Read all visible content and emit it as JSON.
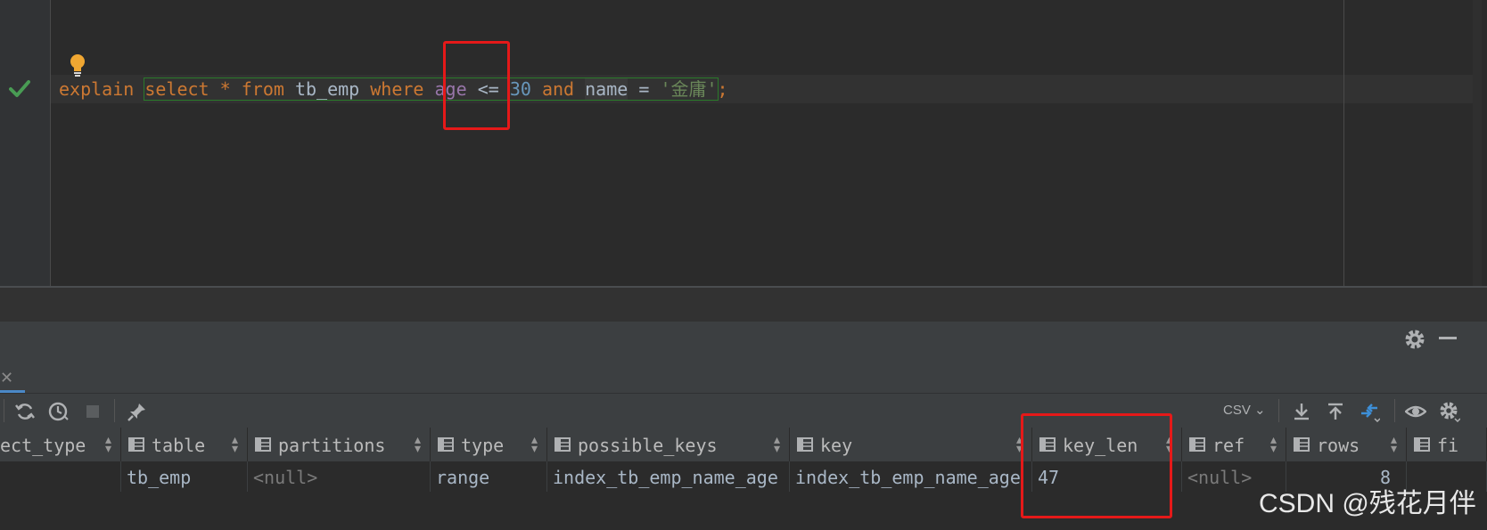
{
  "editor": {
    "tokens": [
      {
        "t": "explain",
        "c": "kw"
      },
      {
        "t": " ",
        "c": "op"
      },
      {
        "t": "select",
        "c": "kw"
      },
      {
        "t": " ",
        "c": "op"
      },
      {
        "t": "*",
        "c": "kw"
      },
      {
        "t": " ",
        "c": "op"
      },
      {
        "t": "from",
        "c": "kw"
      },
      {
        "t": " ",
        "c": "op"
      },
      {
        "t": "tb_emp",
        "c": "ident"
      },
      {
        "t": " ",
        "c": "op"
      },
      {
        "t": "where",
        "c": "kw"
      },
      {
        "t": " ",
        "c": "op"
      },
      {
        "t": "age",
        "c": "col"
      },
      {
        "t": " ",
        "c": "op"
      },
      {
        "t": "<=",
        "c": "op"
      },
      {
        "t": " ",
        "c": "op"
      },
      {
        "t": "30",
        "c": "num"
      },
      {
        "t": " ",
        "c": "op"
      },
      {
        "t": "and",
        "c": "kw"
      },
      {
        "t": " ",
        "c": "op"
      },
      {
        "t": "name",
        "c": "ident"
      },
      {
        "t": " ",
        "c": "op"
      },
      {
        "t": "=",
        "c": "op"
      },
      {
        "t": " ",
        "c": "op"
      },
      {
        "t": "'金庸'",
        "c": "str"
      },
      {
        "t": ";",
        "c": "kw"
      }
    ]
  },
  "toolbar": {
    "format": "CSV"
  },
  "grid": {
    "columns": [
      {
        "label": "ect_type",
        "icon": false
      },
      {
        "label": "table",
        "icon": true
      },
      {
        "label": "partitions",
        "icon": true
      },
      {
        "label": "type",
        "icon": true
      },
      {
        "label": "possible_keys",
        "icon": true
      },
      {
        "label": "key",
        "icon": true
      },
      {
        "label": "key_len",
        "icon": true
      },
      {
        "label": "ref",
        "icon": true
      },
      {
        "label": "rows",
        "icon": true
      },
      {
        "label": "fi",
        "icon": true
      }
    ],
    "row": [
      "",
      "tb_emp",
      "<null>",
      "range",
      "index_tb_emp_name_age",
      "index_tb_emp_name_age",
      "47",
      "<null>",
      "8",
      ""
    ]
  },
  "watermark": "CSDN @残花月伴",
  "colors": {
    "highlight_box": "#e51919",
    "keyword": "#cc7832",
    "ok_check": "#499c54"
  }
}
